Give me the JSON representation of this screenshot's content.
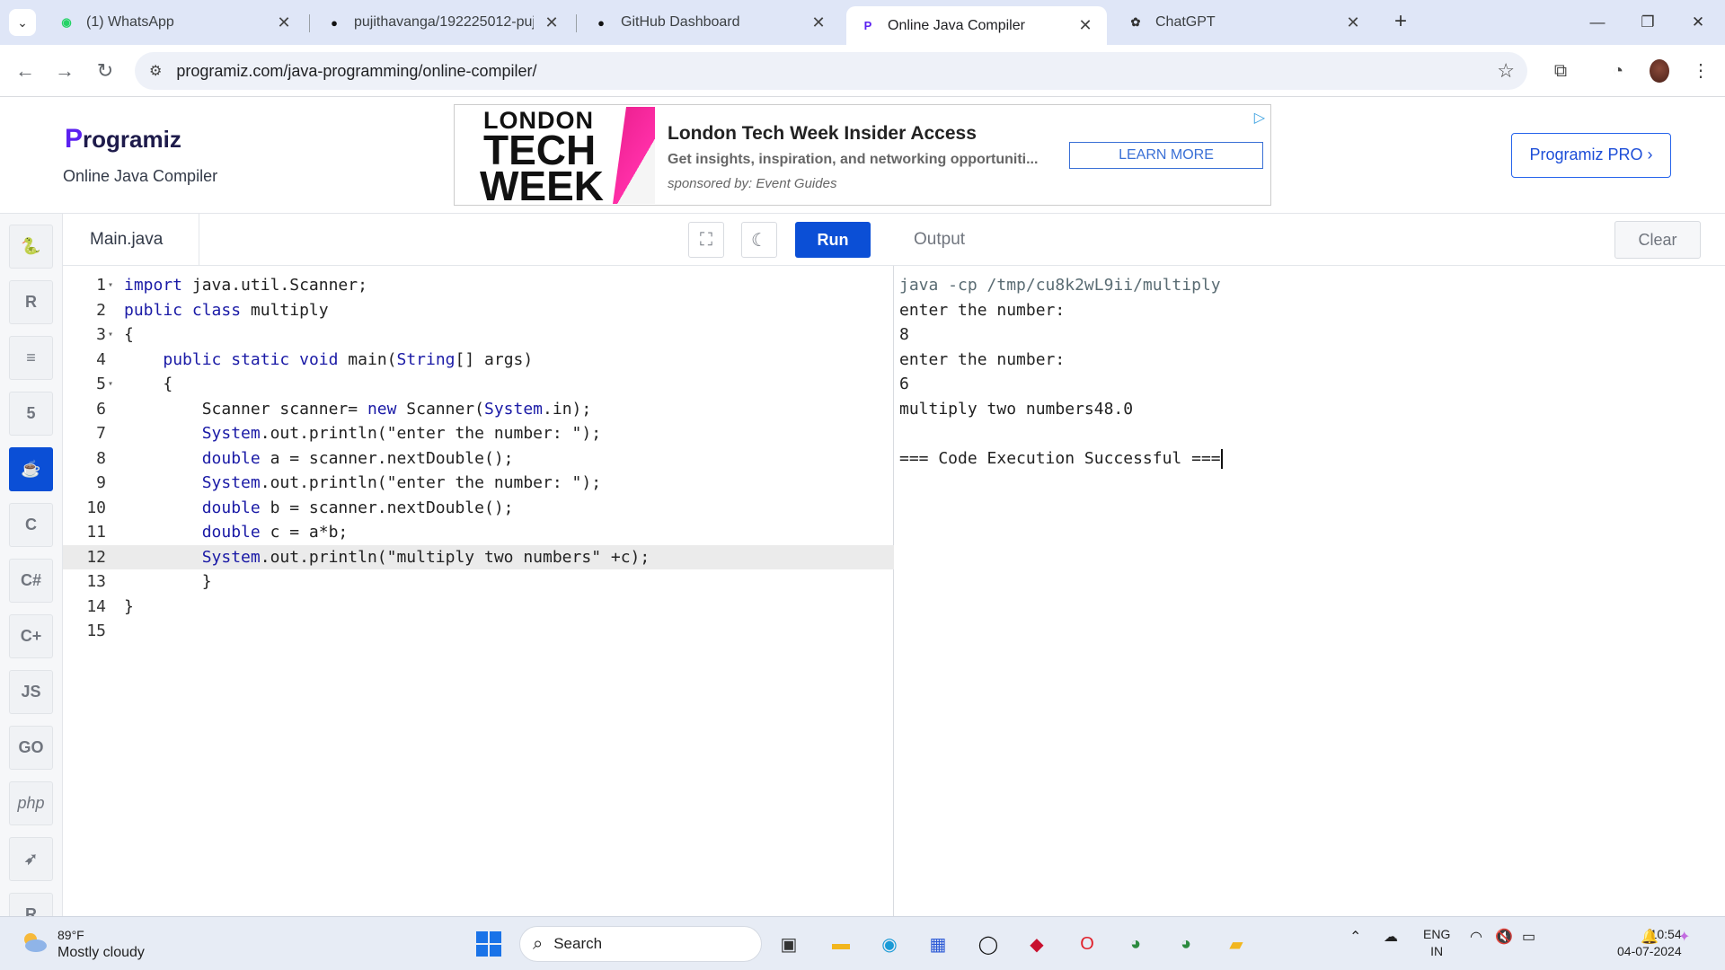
{
  "browser": {
    "tabs": [
      {
        "title": "(1) WhatsApp",
        "icon": "whatsapp-icon",
        "color": "#25d366"
      },
      {
        "title": "pujithavanga/192225012-pujith",
        "icon": "github-icon",
        "color": "#111111"
      },
      {
        "title": "GitHub Dashboard",
        "icon": "github-icon",
        "color": "#111111"
      },
      {
        "title": "Online Java Compiler",
        "icon": "programiz-icon",
        "color": "#5b21f0"
      },
      {
        "title": "ChatGPT",
        "icon": "chatgpt-icon",
        "color": "#333333"
      }
    ],
    "active_tab_index": 3,
    "url": "programiz.com/java-programming/online-compiler/"
  },
  "site": {
    "logo_text": "rogramiz",
    "logo_p": "P",
    "subtitle": "Online Java Compiler",
    "pro_button": "Programiz PRO ›"
  },
  "ad": {
    "logo_line1": "LONDON",
    "logo_line2": "TECH",
    "logo_line3": "WEEK",
    "title": "London Tech Week Insider Access",
    "description": "Get insights, inspiration, and networking opportuniti...",
    "sponsor": "sponsored by: Event Guides",
    "cta": "LEARN MORE"
  },
  "sidebar": {
    "languages": [
      {
        "name": "python",
        "glyph": "🐍"
      },
      {
        "name": "r",
        "glyph": "R"
      },
      {
        "name": "sql",
        "glyph": "≡"
      },
      {
        "name": "html",
        "glyph": "5"
      },
      {
        "name": "java",
        "glyph": "☕",
        "active": true
      },
      {
        "name": "c",
        "glyph": "C"
      },
      {
        "name": "csharp",
        "glyph": "C#"
      },
      {
        "name": "cpp",
        "glyph": "C+"
      },
      {
        "name": "js",
        "glyph": "JS"
      },
      {
        "name": "go",
        "glyph": "GO"
      },
      {
        "name": "php",
        "glyph": "php"
      },
      {
        "name": "swift",
        "glyph": "➶"
      },
      {
        "name": "rust",
        "glyph": "R"
      }
    ]
  },
  "editor": {
    "filename": "Main.java",
    "run_label": "Run",
    "highlighted_line": 12,
    "lines": [
      {
        "n": "1",
        "fold": true,
        "text": "import java.util.Scanner;"
      },
      {
        "n": "2",
        "fold": false,
        "text": "public class multiply"
      },
      {
        "n": "3",
        "fold": true,
        "text": "{"
      },
      {
        "n": "4",
        "fold": false,
        "text": "    public static void main(String[] args)"
      },
      {
        "n": "5",
        "fold": true,
        "text": "    {"
      },
      {
        "n": "6",
        "fold": false,
        "text": "        Scanner scanner= new Scanner(System.in);"
      },
      {
        "n": "7",
        "fold": false,
        "text": "        System.out.println(\"enter the number: \");"
      },
      {
        "n": "8",
        "fold": false,
        "text": "        double a = scanner.nextDouble();"
      },
      {
        "n": "9",
        "fold": false,
        "text": "        System.out.println(\"enter the number: \");"
      },
      {
        "n": "10",
        "fold": false,
        "text": "        double b = scanner.nextDouble();"
      },
      {
        "n": "11",
        "fold": false,
        "text": "        double c = a*b;"
      },
      {
        "n": "12",
        "fold": false,
        "text": "        System.out.println(\"multiply two numbers\" +c);"
      },
      {
        "n": "13",
        "fold": false,
        "text": "        }"
      },
      {
        "n": "14",
        "fold": false,
        "text": "}"
      },
      {
        "n": "15",
        "fold": false,
        "text": ""
      }
    ]
  },
  "output": {
    "title": "Output",
    "clear_label": "Clear",
    "lines": [
      {
        "text": "java -cp /tmp/cu8k2wL9ii/multiply",
        "kind": "cmd"
      },
      {
        "text": "enter the number:",
        "kind": "out"
      },
      {
        "text": "8",
        "kind": "out"
      },
      {
        "text": "enter the number:",
        "kind": "out"
      },
      {
        "text": "6",
        "kind": "out"
      },
      {
        "text": "multiply two numbers48.0",
        "kind": "out"
      },
      {
        "text": "",
        "kind": "out"
      },
      {
        "text": "=== Code Execution Successful ===",
        "kind": "out"
      }
    ]
  },
  "taskbar": {
    "temperature": "89°F",
    "weather": "Mostly cloudy",
    "search_placeholder": "Search",
    "lang_line1": "ENG",
    "lang_line2": "IN",
    "time": "10:54",
    "date": "04-07-2024"
  },
  "colors": {
    "accent": "#0b4fd6",
    "tabstrip": "#dfe6f7",
    "taskbar": "#e7ecf5"
  }
}
